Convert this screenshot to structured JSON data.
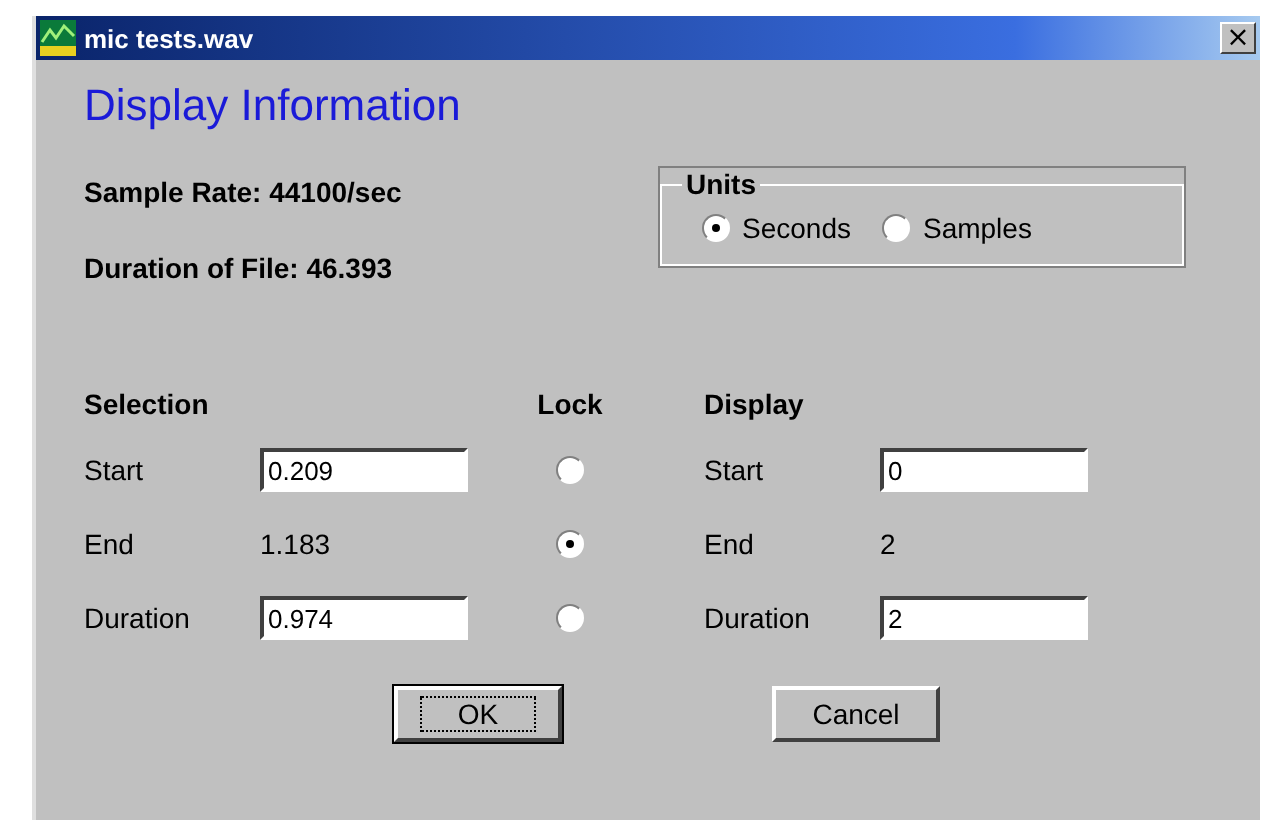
{
  "window": {
    "title": "mic tests.wav",
    "close": "×"
  },
  "heading": "Display Information",
  "info": [
    "Sample Rate: 44100/sec",
    "Duration of File: 46.393"
  ],
  "units": {
    "label": "Units",
    "options": [
      {
        "label": "Seconds",
        "selected": true
      },
      {
        "label": "Samples",
        "selected": false
      }
    ]
  },
  "headers": {
    "selection": "Selection",
    "lock": "Lock",
    "display": "Display"
  },
  "rows": [
    {
      "label": "Start",
      "selection": {
        "kind": "field",
        "value": "0.209"
      },
      "locked": false,
      "display_label": "Start",
      "display": {
        "kind": "field",
        "value": "0"
      }
    },
    {
      "label": "End",
      "selection": {
        "kind": "text",
        "value": "1.183"
      },
      "locked": true,
      "display_label": "End",
      "display": {
        "kind": "text",
        "value": "2"
      }
    },
    {
      "label": "Duration",
      "selection": {
        "kind": "field",
        "value": "0.974"
      },
      "locked": false,
      "display_label": "Duration",
      "display": {
        "kind": "field",
        "value": "2"
      }
    }
  ],
  "buttons": [
    {
      "label": "OK",
      "default": true
    },
    {
      "label": "Cancel",
      "default": false
    }
  ]
}
